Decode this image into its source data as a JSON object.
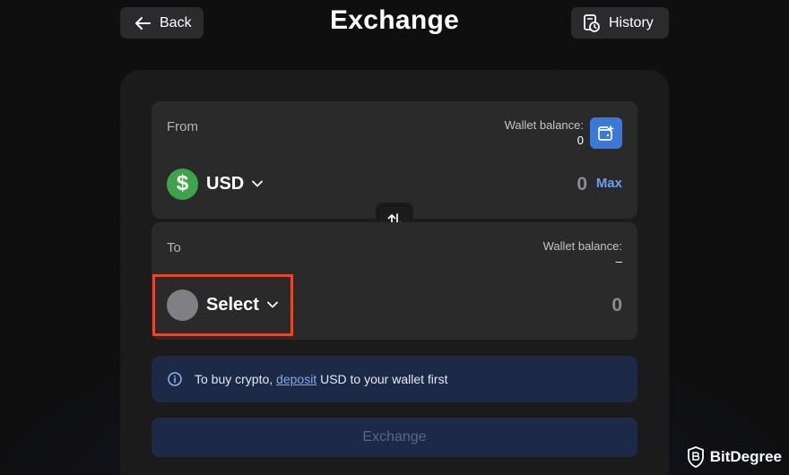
{
  "header": {
    "back_label": "Back",
    "title": "Exchange",
    "history_label": "History"
  },
  "from": {
    "label": "From",
    "wallet_balance_label": "Wallet balance:",
    "wallet_balance_value": "0",
    "currency": "USD",
    "currency_symbol": "$",
    "amount": "0",
    "max_label": "Max"
  },
  "to": {
    "label": "To",
    "wallet_balance_label": "Wallet balance:",
    "wallet_balance_value": "–",
    "currency": "Select",
    "amount": "0"
  },
  "info": {
    "prefix": "To buy crypto, ",
    "link": "deposit",
    "suffix": " USD to your wallet first"
  },
  "action": {
    "exchange_label": "Exchange"
  },
  "brand": {
    "name": "BitDegree"
  },
  "colors": {
    "accent": "#3b78d8",
    "highlight": "#e2492c",
    "usd_coin": "#3fa34d"
  }
}
